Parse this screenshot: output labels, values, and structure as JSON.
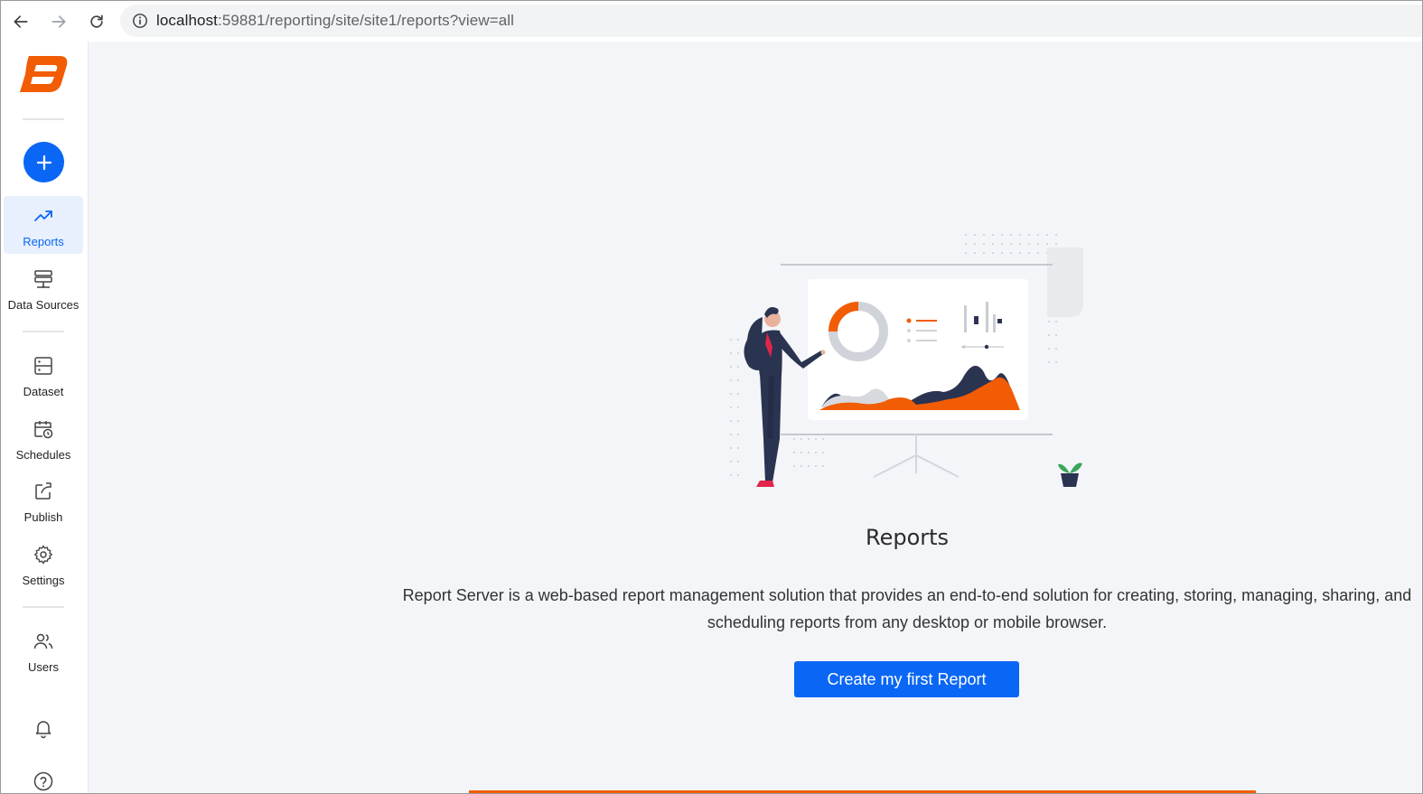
{
  "browser": {
    "url_host": "localhost",
    "url_path": ":59881/reporting/site/site1/reports?view=all"
  },
  "sidebar": {
    "items": [
      {
        "label": "Reports",
        "icon": "trending-up-icon",
        "active": true
      },
      {
        "label": "Data Sources",
        "icon": "server-icon"
      },
      {
        "label": "Dataset",
        "icon": "dataset-icon"
      },
      {
        "label": "Schedules",
        "icon": "calendar-clock-icon"
      },
      {
        "label": "Publish",
        "icon": "share-icon"
      },
      {
        "label": "Settings",
        "icon": "gear-icon"
      },
      {
        "label": "Users",
        "icon": "users-icon"
      }
    ]
  },
  "main": {
    "title": "Reports",
    "description": "Report Server is a web-based report management solution that provides an end-to-end solution for creating, storing, managing, sharing, and scheduling reports from any desktop or mobile browser.",
    "cta_label": "Create my first Report"
  },
  "colors": {
    "accent": "#0a66f5",
    "brand": "#f25c05",
    "navy": "#2a3350"
  }
}
